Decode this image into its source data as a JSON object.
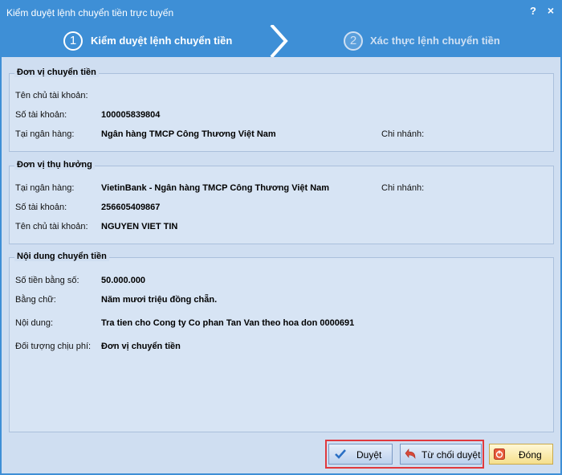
{
  "window": {
    "title": "Kiểm duyệt lệnh chuyển tiền trực tuyến",
    "help": "?",
    "close": "×"
  },
  "steps": [
    {
      "number": "1",
      "label": "Kiểm duyệt lệnh chuyển tiền"
    },
    {
      "number": "2",
      "label": "Xác thực lệnh chuyển tiền"
    }
  ],
  "sender": {
    "title": "Đơn vị chuyển tiền",
    "account_name_label": "Tên chủ tài khoản:",
    "account_name_value": "",
    "account_number_label": "Số tài khoản:",
    "account_number_value": "100005839804",
    "bank_label": "Tại ngân hàng:",
    "bank_value": "Ngân hàng TMCP Công Thương Việt Nam",
    "branch_label": "Chi nhánh:"
  },
  "beneficiary": {
    "title": "Đơn vị thụ hưởng",
    "bank_label": "Tại ngân hàng:",
    "bank_value": "VietinBank - Ngân hàng TMCP Công Thương Việt Nam",
    "branch_label": "Chi nhánh:",
    "account_number_label": "Số tài khoản:",
    "account_number_value": "256605409867",
    "account_name_label": "Tên chủ tài khoản:",
    "account_name_value": "NGUYEN VIET TIN"
  },
  "content": {
    "title": "Nội dung chuyển tiền",
    "amount_label": "Số tiền bằng số:",
    "amount_value": "50.000.000",
    "words_label": "Bằng chữ:",
    "words_value": "Năm mươi triệu đồng chẵn.",
    "desc_label": "Nội dung:",
    "desc_value": "Tra tien cho Cong ty Co phan Tan Van theo hoa don 0000691",
    "fee_label": "Đối tượng chịu phí:",
    "fee_value": "Đơn vị chuyển tiền"
  },
  "buttons": {
    "approve": "Duyệt",
    "reject": "Từ chối duyệt",
    "close": "Đóng"
  },
  "colors": {
    "titlebar": "#3e8fd6",
    "panel": "#cfdef1",
    "highlight": "#e0393e"
  }
}
